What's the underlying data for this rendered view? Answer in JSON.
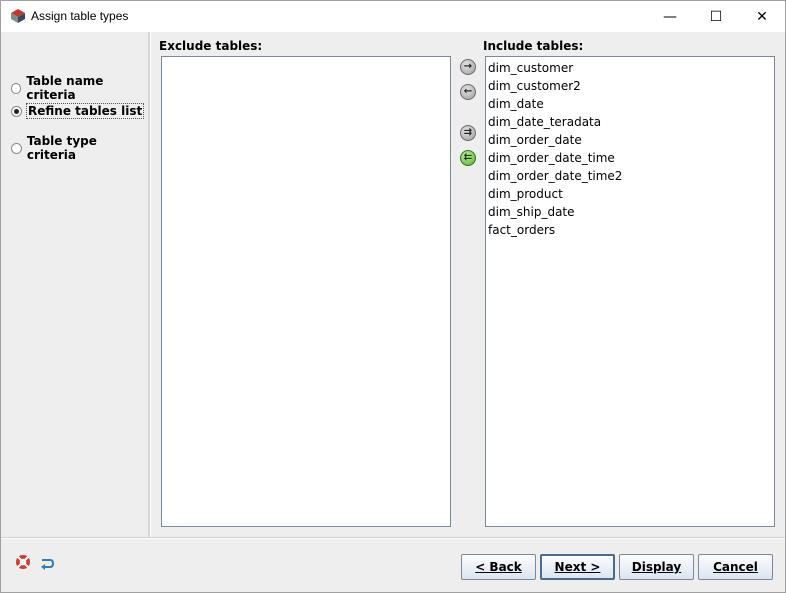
{
  "window": {
    "title": "Assign table types"
  },
  "titlebar": {
    "minimize_glyph": "—",
    "maximize_glyph": "☐",
    "close_glyph": "✕"
  },
  "criteria": {
    "options": [
      {
        "label": "Table name criteria",
        "selected": false
      },
      {
        "label": "Refine tables list",
        "selected": true
      },
      {
        "label": "Table type criteria",
        "selected": false
      }
    ]
  },
  "exclude": {
    "label": "Exclude tables:",
    "items": []
  },
  "include": {
    "label": "Include tables:",
    "items": [
      "dim_customer",
      "dim_customer2",
      "dim_date",
      "dim_date_teradata",
      "dim_order_date",
      "dim_order_date_time",
      "dim_order_date_time2",
      "dim_product",
      "dim_ship_date",
      "fact_orders"
    ]
  },
  "transfer": {
    "move_right_icon": "arrow-right-icon",
    "move_left_icon": "arrow-left-icon",
    "move_all_right_icon": "double-arrow-right-icon",
    "move_all_left_icon": "double-arrow-left-icon",
    "move_right_glyph": "→",
    "move_left_glyph": "←",
    "move_all_right_glyph": "⇉",
    "move_all_left_glyph": "⇇"
  },
  "footer": {
    "back_label": "< Back",
    "next_label": "Next >",
    "display_label": "Display",
    "cancel_label": "Cancel"
  },
  "colors": {
    "accent": "#4fa82b",
    "window_bg": "#eeeeee",
    "list_border": "#7a8a99"
  }
}
